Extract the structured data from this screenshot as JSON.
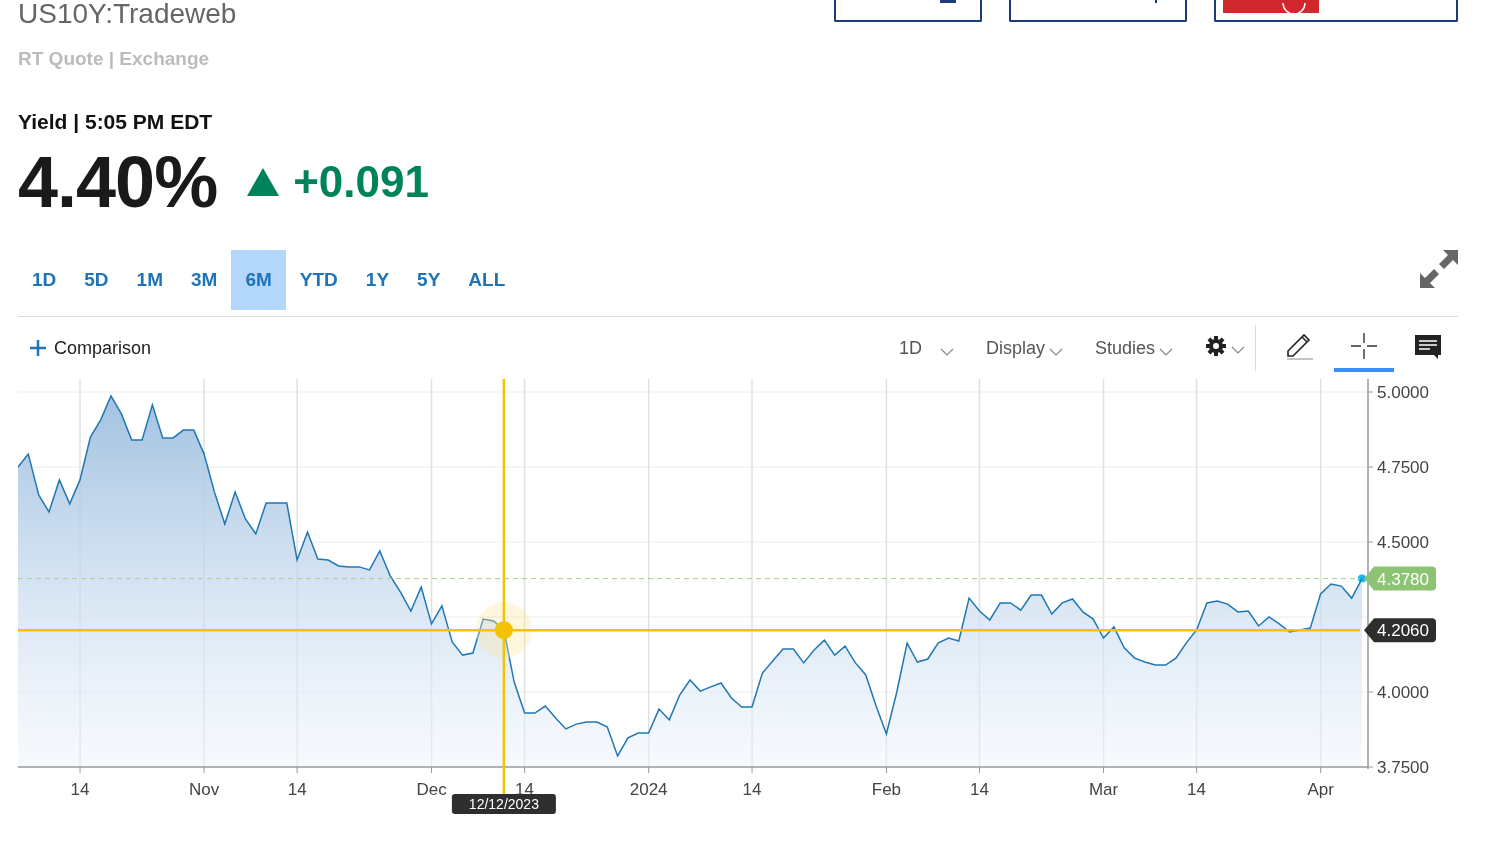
{
  "header": {
    "symbol": "US10Y:Tradeweb",
    "source": "RT Quote | Exchange",
    "top_buttons": [
      {
        "kind": "outline-square"
      },
      {
        "kind": "outline-mark"
      },
      {
        "kind": "red"
      }
    ]
  },
  "quote": {
    "label": "Yield | 5:05 PM EDT",
    "price": "4.40%",
    "rising": true,
    "change": "+0.091"
  },
  "ranges": [
    {
      "label": "1D",
      "selected": false
    },
    {
      "label": "5D",
      "selected": false
    },
    {
      "label": "1M",
      "selected": false
    },
    {
      "label": "3M",
      "selected": false
    },
    {
      "label": "6M",
      "selected": true
    },
    {
      "label": "YTD",
      "selected": false
    },
    {
      "label": "1Y",
      "selected": false
    },
    {
      "label": "5Y",
      "selected": false
    },
    {
      "label": "ALL",
      "selected": false
    }
  ],
  "toolbar": {
    "comparison": "Comparison",
    "menus": [
      {
        "label": "1D"
      },
      {
        "label": "Display"
      },
      {
        "label": "Studies"
      }
    ],
    "tools": [
      {
        "kind": "settings",
        "selected": false
      },
      {
        "kind": "draw",
        "selected": false
      },
      {
        "kind": "crosshair",
        "selected": true
      },
      {
        "kind": "comment",
        "selected": false
      }
    ]
  },
  "chart": {
    "chart_data": {
      "type": "area",
      "grid": true,
      "ylim": [
        3.75,
        5.0
      ],
      "categories": [
        null,
        null,
        null,
        null,
        null,
        null,
        "14",
        null,
        null,
        null,
        null,
        null,
        null,
        null,
        null,
        null,
        null,
        null,
        "Nov",
        null,
        null,
        null,
        null,
        null,
        null,
        null,
        null,
        "14",
        null,
        null,
        null,
        null,
        null,
        null,
        null,
        null,
        null,
        null,
        null,
        null,
        "Dec",
        null,
        null,
        null,
        null,
        null,
        null,
        "12/12/2023",
        null,
        "14",
        null,
        null,
        null,
        null,
        null,
        null,
        null,
        null,
        null,
        null,
        null,
        "2024",
        null,
        null,
        null,
        null,
        null,
        null,
        null,
        null,
        null,
        "14",
        null,
        null,
        null,
        null,
        null,
        null,
        null,
        null,
        null,
        null,
        null,
        null,
        "Feb",
        null,
        null,
        null,
        null,
        null,
        null,
        null,
        null,
        "14",
        null,
        null,
        null,
        null,
        null,
        null,
        null,
        null,
        null,
        null,
        null,
        "Mar",
        null,
        null,
        null,
        null,
        null,
        null,
        null,
        null,
        "14",
        null,
        null,
        null,
        null,
        null,
        null,
        null,
        null,
        null,
        null,
        null,
        "Apr",
        null,
        null,
        null,
        null
      ],
      "yticks": [
        {
          "value": 3.75,
          "label": "3.7500"
        },
        {
          "value": 4.0,
          "label": "4.0000"
        },
        {
          "value": 4.5,
          "label": "4.5000"
        },
        {
          "value": 4.75,
          "label": "4.7500"
        },
        {
          "value": 5.0,
          "label": "5.0000"
        }
      ],
      "series": [
        {
          "color": "#1f77b4",
          "values": [
            4.75,
            4.793,
            4.657,
            4.6,
            4.707,
            4.627,
            4.707,
            4.85,
            4.907,
            4.987,
            4.927,
            4.84,
            4.84,
            4.957,
            4.847,
            4.847,
            4.873,
            4.873,
            4.793,
            4.667,
            4.56,
            4.667,
            4.577,
            4.527,
            4.63,
            4.63,
            4.63,
            4.44,
            4.533,
            4.443,
            4.44,
            4.42,
            4.417,
            4.417,
            4.407,
            4.47,
            4.387,
            4.333,
            4.27,
            4.35,
            4.227,
            4.287,
            4.167,
            4.123,
            4.13,
            4.243,
            4.237,
            4.206,
            4.033,
            3.93,
            3.93,
            3.953,
            3.913,
            3.877,
            3.893,
            3.9,
            3.9,
            3.883,
            3.787,
            3.847,
            3.863,
            3.863,
            3.943,
            3.907,
            3.99,
            4.04,
            4.003,
            4.017,
            4.03,
            3.98,
            3.95,
            3.95,
            4.063,
            4.103,
            4.143,
            4.143,
            4.097,
            4.14,
            4.173,
            4.123,
            4.153,
            4.097,
            4.057,
            3.953,
            3.86,
            4.0,
            4.163,
            4.1,
            4.11,
            4.163,
            4.18,
            4.17,
            4.313,
            4.27,
            4.24,
            4.297,
            4.297,
            4.273,
            4.323,
            4.323,
            4.26,
            4.297,
            4.31,
            4.267,
            4.243,
            4.18,
            4.217,
            4.147,
            4.113,
            4.1,
            4.09,
            4.09,
            4.113,
            4.163,
            4.207,
            4.297,
            4.303,
            4.293,
            4.267,
            4.27,
            4.22,
            4.25,
            4.227,
            4.2,
            4.207,
            4.213,
            4.327,
            4.36,
            4.353,
            4.313,
            4.378
          ]
        }
      ],
      "ref_lines": [
        {
          "axis": "y",
          "value": 4.378,
          "label": "4.3780"
        },
        {
          "axis": "y",
          "value": 4.206,
          "label": "4.2060"
        },
        {
          "axis": "x",
          "value": "12/12/2023"
        }
      ]
    }
  }
}
